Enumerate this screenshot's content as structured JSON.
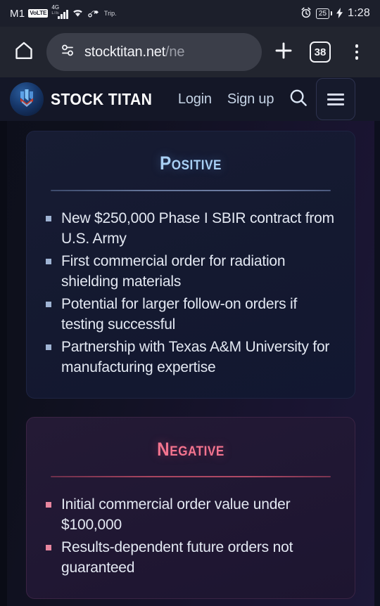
{
  "status_bar": {
    "carrier": "M1",
    "volte_badge": "VoLTE",
    "network_type": "4G",
    "network_sub": "LTE",
    "app_label": "Trip.",
    "battery_level": "25",
    "time": "1:28",
    "icons": [
      "signal-bars-icon",
      "wifi-icon",
      "vpn-key-icon",
      "alarm-clock-icon",
      "battery-icon",
      "charging-bolt-icon"
    ]
  },
  "browser": {
    "home_icon": "home-icon",
    "site_settings_icon": "tune-sliders-icon",
    "url_main": "stocktitan.net",
    "url_dim": "/ne",
    "new_tab_icon": "plus-icon",
    "tab_count": "38",
    "menu_icon": "overflow-menu-icon"
  },
  "site_header": {
    "logo_icon": "stock-titan-logo-icon",
    "brand": "STOCK TITAN",
    "login_label": "Login",
    "signup_label": "Sign up",
    "search_icon": "search-icon",
    "menu_icon": "hamburger-menu-icon"
  },
  "cards": [
    {
      "id": "positive",
      "title": "Positive",
      "accent": "#a9d0f5",
      "bullets": [
        "New $250,000 Phase I SBIR contract from U.S. Army",
        "First commercial order for radiation shielding materials",
        "Potential for larger follow-on orders if testing successful",
        "Partnership with Texas A&M University for manufacturing expertise"
      ]
    },
    {
      "id": "negative",
      "title": "Negative",
      "accent": "#f4748f",
      "bullets": [
        "Initial commercial order value under $100,000",
        "Results-dependent future orders not guaranteed"
      ]
    }
  ]
}
